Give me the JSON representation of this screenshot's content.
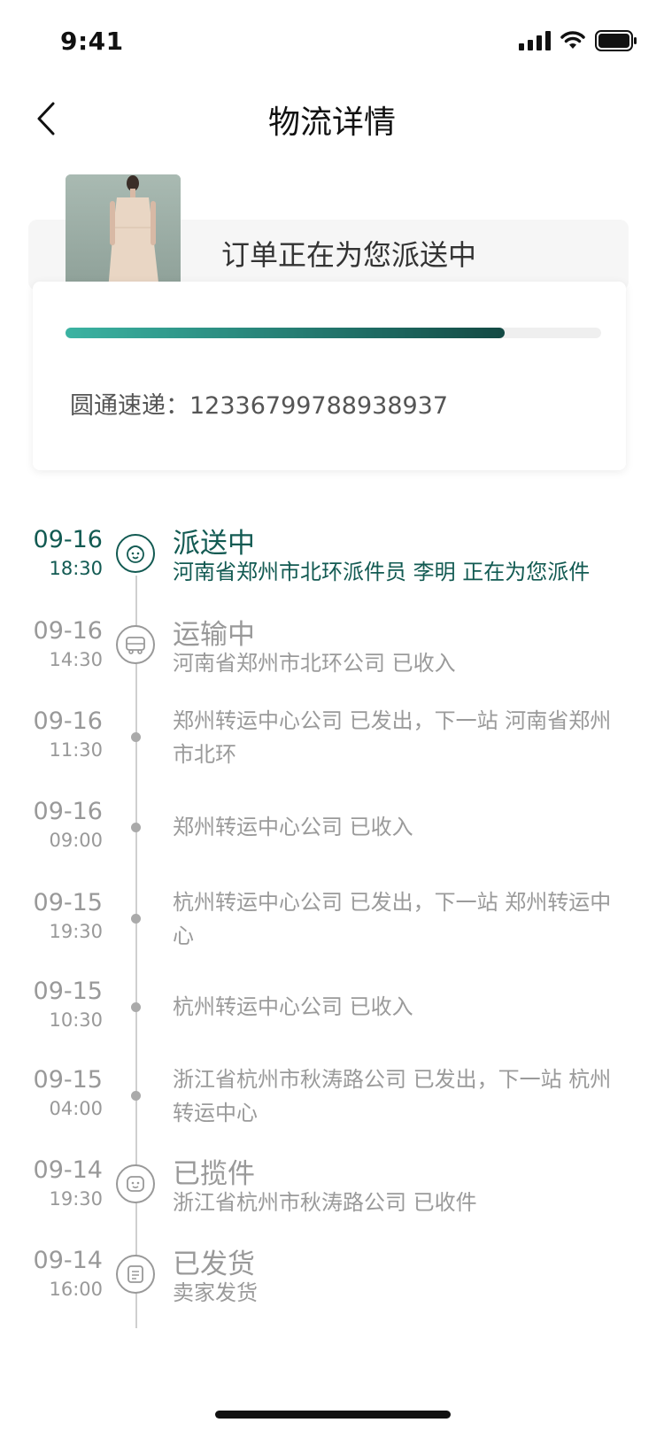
{
  "status_bar": {
    "time": "9:41"
  },
  "nav": {
    "title": "物流详情"
  },
  "order": {
    "status": "订单正在为您派送中",
    "progress": 0.82,
    "tracking": "圆通速递：12336799788938937",
    "accent": "#125a52"
  },
  "timeline": [
    {
      "date": "09-16",
      "time": "18:30",
      "title": "派送中",
      "desc": "河南省郑州市北环派件员 李明 正在为您派件",
      "icon": "courier-face-icon",
      "active": true
    },
    {
      "date": "09-16",
      "time": "14:30",
      "title": "运输中",
      "desc": "河南省郑州市北环公司 已收入",
      "icon": "truck-icon"
    },
    {
      "date": "09-16",
      "time": "11:30",
      "title": "",
      "desc": "郑州转运中心公司 已发出，下一站 河南省郑州市北环"
    },
    {
      "date": "09-16",
      "time": "09:00",
      "title": "",
      "desc": "郑州转运中心公司 已收入"
    },
    {
      "date": "09-15",
      "time": "19:30",
      "title": "",
      "desc": "杭州转运中心公司 已发出，下一站 郑州转运中心"
    },
    {
      "date": "09-15",
      "time": "10:30",
      "title": "",
      "desc": "杭州转运中心公司 已收入"
    },
    {
      "date": "09-15",
      "time": "04:00",
      "title": "",
      "desc": "浙江省杭州市秋涛路公司 已发出，下一站 杭州转运中心"
    },
    {
      "date": "09-14",
      "time": "19:30",
      "title": "已揽件",
      "desc": "浙江省杭州市秋涛路公司 已收件",
      "icon": "package-face-icon"
    },
    {
      "date": "09-14",
      "time": "16:00",
      "title": "已发货",
      "desc": "卖家发货",
      "icon": "box-icon"
    }
  ]
}
